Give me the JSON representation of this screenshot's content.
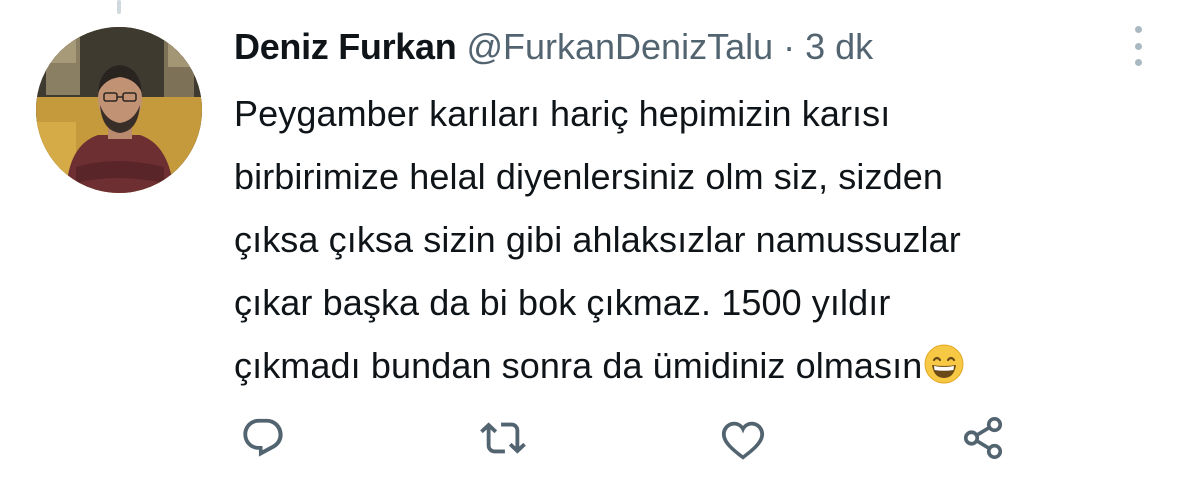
{
  "tweet": {
    "display_name": "Deniz Furkan",
    "handle": "@FurkanDenizTalu",
    "separator": "·",
    "time": "3 dk",
    "text_lines": [
      "Peygamber karıları hariç hepimizin karısı",
      "birbirimize helal diyenlersiniz olm siz, sizden",
      "çıksa çıksa sizin gibi ahlaksızlar namussuzlar",
      "çıkar başka da bi bok çıkmaz. 1500 yıldır",
      "çıkmadı bundan sonra da ümidiniz olmasın"
    ],
    "emoji": "grinning-face-with-smiling-eyes"
  },
  "actions": {
    "icons": [
      "reply-icon",
      "retweet-icon",
      "like-icon",
      "share-icon"
    ]
  },
  "colors": {
    "text": "#0f1419",
    "secondary": "#536471",
    "icon": "#536471"
  }
}
